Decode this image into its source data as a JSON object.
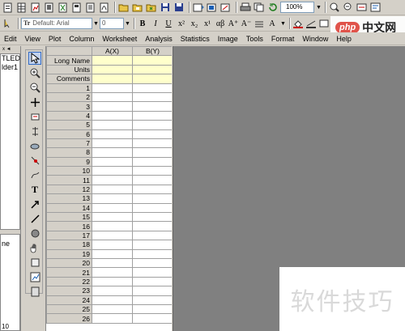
{
  "toolbar1": {
    "zoom": "100%"
  },
  "toolbar2": {
    "font_name": "Default: Arial",
    "font_size": "0",
    "bold": "B",
    "italic": "I",
    "underline": "U"
  },
  "menu": [
    {
      "label": "Edit"
    },
    {
      "label": "View"
    },
    {
      "label": "Plot"
    },
    {
      "label": "Column"
    },
    {
      "label": "Worksheet"
    },
    {
      "label": "Analysis"
    },
    {
      "label": "Statistics"
    },
    {
      "label": "Image"
    },
    {
      "label": "Tools"
    },
    {
      "label": "Format"
    },
    {
      "label": "Window"
    },
    {
      "label": "Help"
    }
  ],
  "explorer": {
    "tree": [
      "TLED",
      "lder1"
    ],
    "list": [
      "ne"
    ],
    "bottom_text": "10"
  },
  "worksheet": {
    "columns": [
      "A(X)",
      "B(Y)"
    ],
    "meta_rows": [
      "Long Name",
      "Units",
      "Comments"
    ],
    "rows": [
      "1",
      "2",
      "3",
      "4",
      "5",
      "6",
      "7",
      "8",
      "9",
      "10",
      "11",
      "12",
      "13",
      "14",
      "15",
      "16",
      "17",
      "18",
      "19",
      "20",
      "21",
      "22",
      "23",
      "24",
      "25",
      "26"
    ]
  },
  "watermark": {
    "logo_php": "php",
    "logo_site": "中文网",
    "text": "软件技巧"
  },
  "colors": {
    "meta_bg": "#ffffcc",
    "workspace": "#808080",
    "chrome": "#d4d0c8"
  }
}
